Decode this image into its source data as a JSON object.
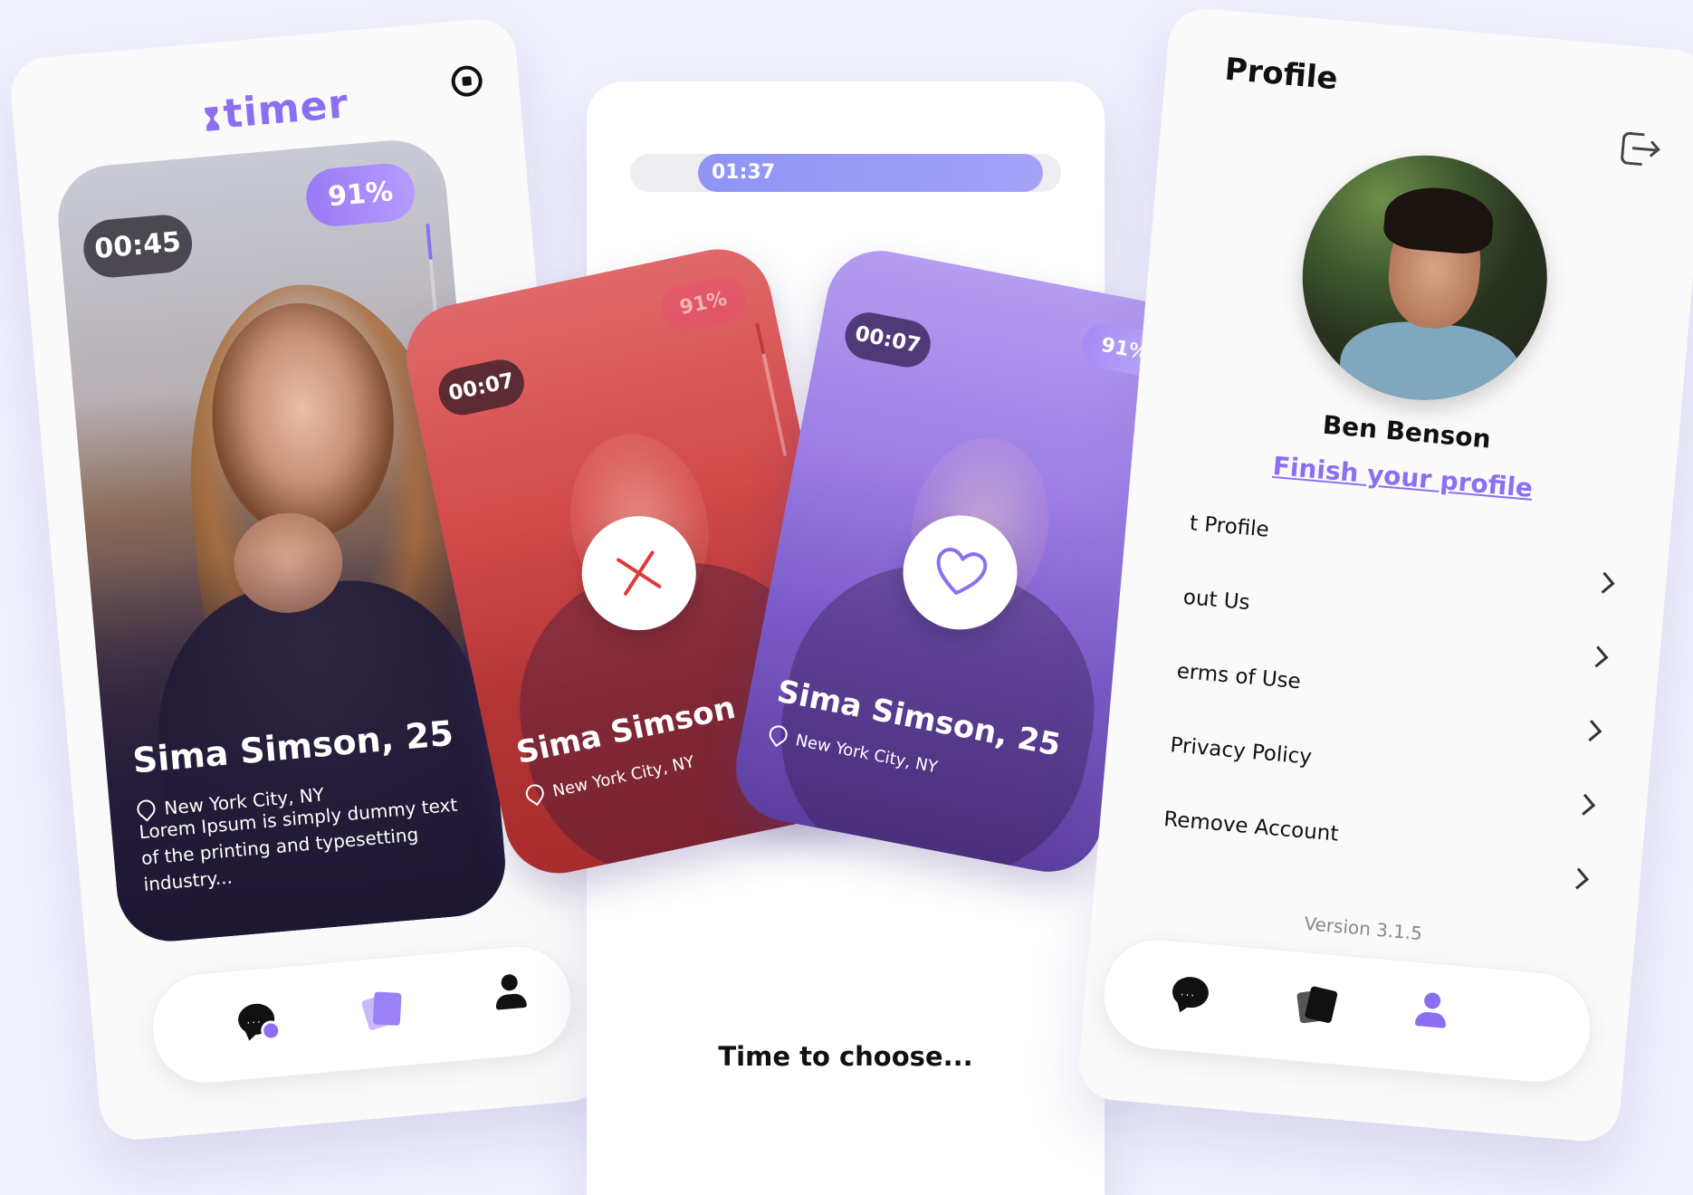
{
  "app": {
    "logo_text": "timer",
    "brand_color": "#8b6ff0"
  },
  "left_screen": {
    "main_card": {
      "timer": "00:45",
      "match": "91%",
      "name": "Sima Simson, 25",
      "location": "New York City, NY",
      "description": "Lorem Ipsum is simply dummy text of the printing and typesetting industry..."
    },
    "nav": {
      "active": "chat-icon"
    }
  },
  "middle_screen": {
    "progress": {
      "label": "01:37",
      "value_fraction": 0.8
    },
    "prompt": "Time to choose..."
  },
  "swipe_cards": {
    "nope": {
      "timer": "00:07",
      "match": "91%",
      "name": "Sima Simson",
      "location": "New York City, NY",
      "color": "#d24a4a"
    },
    "like": {
      "timer": "00:07",
      "match": "91%",
      "name": "Sima Simson, 25",
      "location": "New York City, NY",
      "color": "#9d7fe6"
    }
  },
  "right_screen": {
    "title": "Profile",
    "user_name": "Ben Benson",
    "finish_link": "Finish your profile",
    "menu": [
      {
        "label": "t Profile"
      },
      {
        "label": "out Us"
      },
      {
        "label": "erms of Use"
      },
      {
        "label": "Privacy Policy"
      },
      {
        "label": "Remove Account"
      }
    ],
    "version": "Version 3.1.5",
    "nav": {
      "active": "user-icon"
    }
  }
}
